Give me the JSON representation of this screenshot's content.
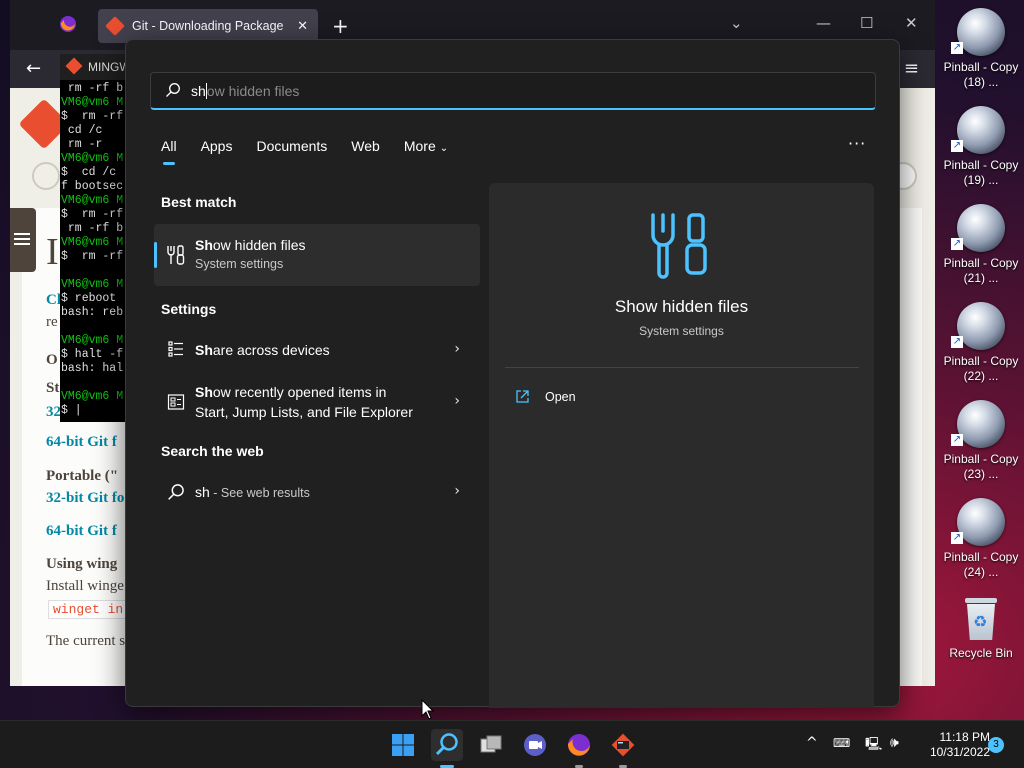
{
  "desktop": {
    "icons": [
      {
        "label": "Pinball - Copy (18) ..."
      },
      {
        "label": "Pinball - Copy (19) ..."
      },
      {
        "label": "Pinball - Copy (21) ..."
      },
      {
        "label": "Pinball - Copy (22) ..."
      },
      {
        "label": "Pinball - Copy (23) ..."
      },
      {
        "label": "Pinball - Copy (24) ..."
      },
      {
        "label": "Recycle Bin"
      }
    ]
  },
  "browser": {
    "tab_title": "Git - Downloading Package",
    "page_lines": {
      "l1": "Cl",
      "l2": "re",
      "l3": "O",
      "l4": "St",
      "l5": "32",
      "l6": "64-bit Git f",
      "l7": "Portable (\"",
      "l8": "32-bit Git fo",
      "l9": "64-bit Git f",
      "l10": "Using wing",
      "l11": "Install winge",
      "l12": "winget in",
      "l13": "The current s"
    }
  },
  "terminal": {
    "title": "MINGW",
    "lines": [
      {
        "t": " rm -rf b",
        "c": ""
      },
      {
        "t": "VM6@vm6 M",
        "c": "g"
      },
      {
        "t": "$  rm -rf",
        "c": ""
      },
      {
        "t": " cd /c",
        "c": ""
      },
      {
        "t": " rm -r",
        "c": ""
      },
      {
        "t": "VM6@vm6 M",
        "c": "g"
      },
      {
        "t": "$  cd /c",
        "c": ""
      },
      {
        "t": "f bootsec",
        "c": ""
      },
      {
        "t": "VM6@vm6 M",
        "c": "g"
      },
      {
        "t": "$  rm -rf",
        "c": ""
      },
      {
        "t": " rm -rf b",
        "c": ""
      },
      {
        "t": "VM6@vm6 M",
        "c": "g"
      },
      {
        "t": "$  rm -rf",
        "c": ""
      },
      {
        "t": "",
        "c": ""
      },
      {
        "t": "VM6@vm6 M",
        "c": "g"
      },
      {
        "t": "$ reboot",
        "c": ""
      },
      {
        "t": "bash: reb",
        "c": ""
      },
      {
        "t": "",
        "c": ""
      },
      {
        "t": "VM6@vm6 M",
        "c": "g"
      },
      {
        "t": "$ halt -f",
        "c": ""
      },
      {
        "t": "bash: hal",
        "c": ""
      },
      {
        "t": "",
        "c": ""
      },
      {
        "t": "VM6@vm6 M",
        "c": "g"
      },
      {
        "t": "$ |",
        "c": ""
      }
    ]
  },
  "search": {
    "typed": "sh",
    "ghost": "ow hidden files",
    "filters": [
      "All",
      "Apps",
      "Documents",
      "Web",
      "More"
    ],
    "best_match_heading": "Best match",
    "best_match": {
      "prefix": "Sh",
      "rest": "ow hidden files",
      "subtitle": "System settings"
    },
    "settings_heading": "Settings",
    "settings_items": [
      {
        "prefix": "Sh",
        "rest": "are across devices"
      },
      {
        "prefix": "Sh",
        "rest": "ow recently opened items in",
        "line2": "Start, Jump Lists, and File Explorer"
      }
    ],
    "web_heading": "Search the web",
    "web_item": {
      "query": "sh",
      "suffix": " - See web results"
    },
    "preview": {
      "title": "Show hidden files",
      "subtitle": "System settings",
      "action": "Open"
    }
  },
  "taskbar": {
    "time": "11:18 PM",
    "date": "10/31/2022",
    "notifications": "3"
  },
  "colors": {
    "accent": "#4cc2ff",
    "panel": "#202020",
    "preview": "#2b2b2b"
  }
}
